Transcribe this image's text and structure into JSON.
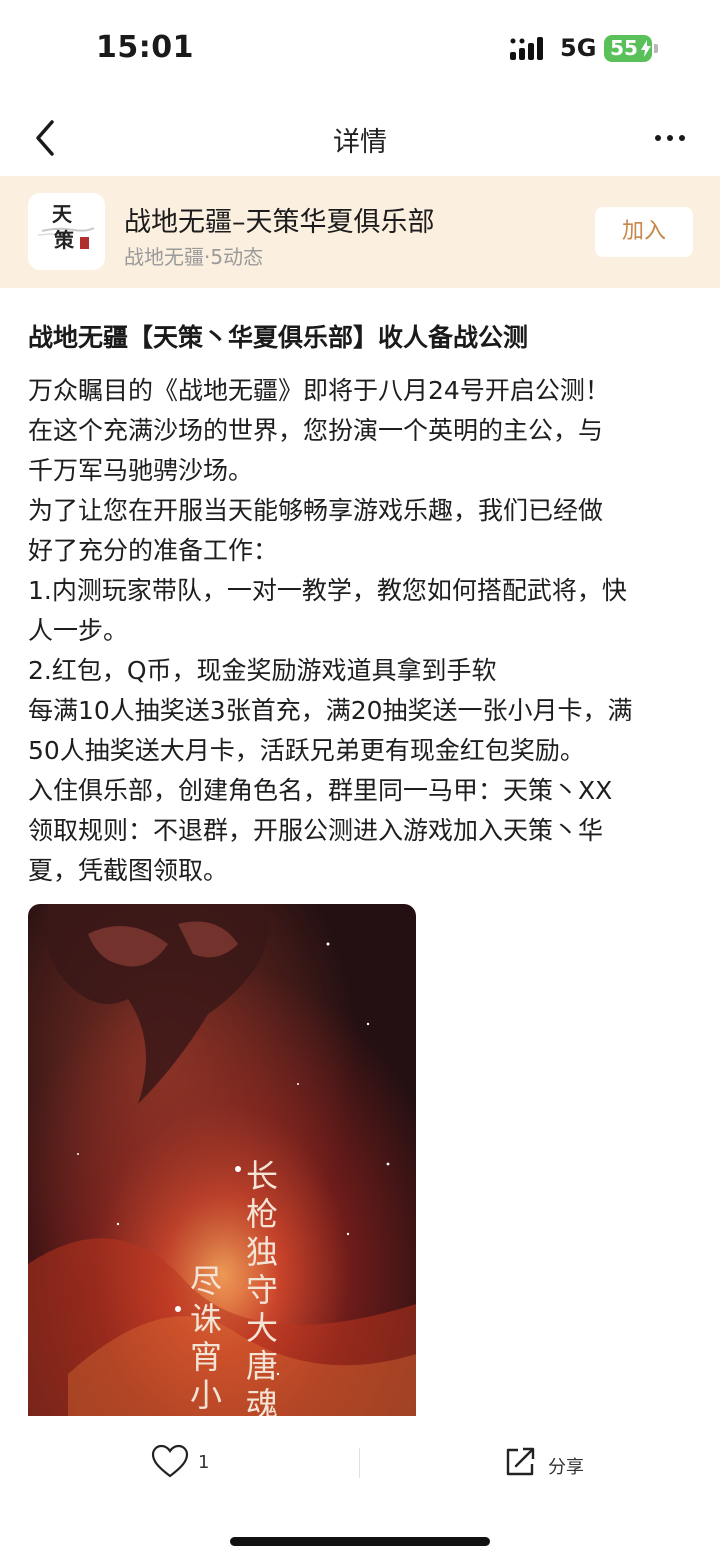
{
  "status_bar": {
    "time": "15:01",
    "network": "5G",
    "battery": "55"
  },
  "nav": {
    "title": "详情"
  },
  "club": {
    "logo_text": "天策",
    "name": "战地无疆–天策华夏俱乐部",
    "meta": "战地无疆·5动态",
    "join_label": "加入"
  },
  "post": {
    "title": "战地无疆【天策丶华夏俱乐部】收人备战公测",
    "lines": [
      "万众瞩目的《战地无疆》即将于八月24号开启公测！",
      "在这个充满沙场的世界，您扮演一个英明的主公，与",
      "千万军马驰骋沙场。",
      "为了让您在开服当天能够畅享游戏乐趣，我们已经做",
      "好了充分的准备工作：",
      "1.内测玩家带队，一对一教学，教您如何搭配武将，快",
      "人一步。",
      "2.红包，Q币，现金奖励游戏道具拿到手软",
      "每满10人抽奖送3张首充，满20抽奖送一张小月卡，满",
      "50人抽奖送大月卡，活跃兄弟更有现金红包奖励。",
      "入住俱乐部，创建角色名，群里同一马甲：天策丶XX",
      "领取规则：不退群，开服公测进入游戏加入天策丶华",
      "夏，凭截图领取。"
    ],
    "image": {
      "poem_line1": "长枪独守大唐魂",
      "poem_line2": "尽诛宵小天"
    }
  },
  "actions": {
    "like_count": "1",
    "share_label": "分享"
  },
  "icons": {
    "back": "back-icon",
    "more": "more-icon",
    "heart": "heart-icon",
    "share": "share-icon",
    "signal": "signal-icon",
    "battery": "battery-icon"
  },
  "colors": {
    "club_bg": "#fbefe0",
    "join_text": "#c7864a",
    "battery": "#5ac05a"
  }
}
